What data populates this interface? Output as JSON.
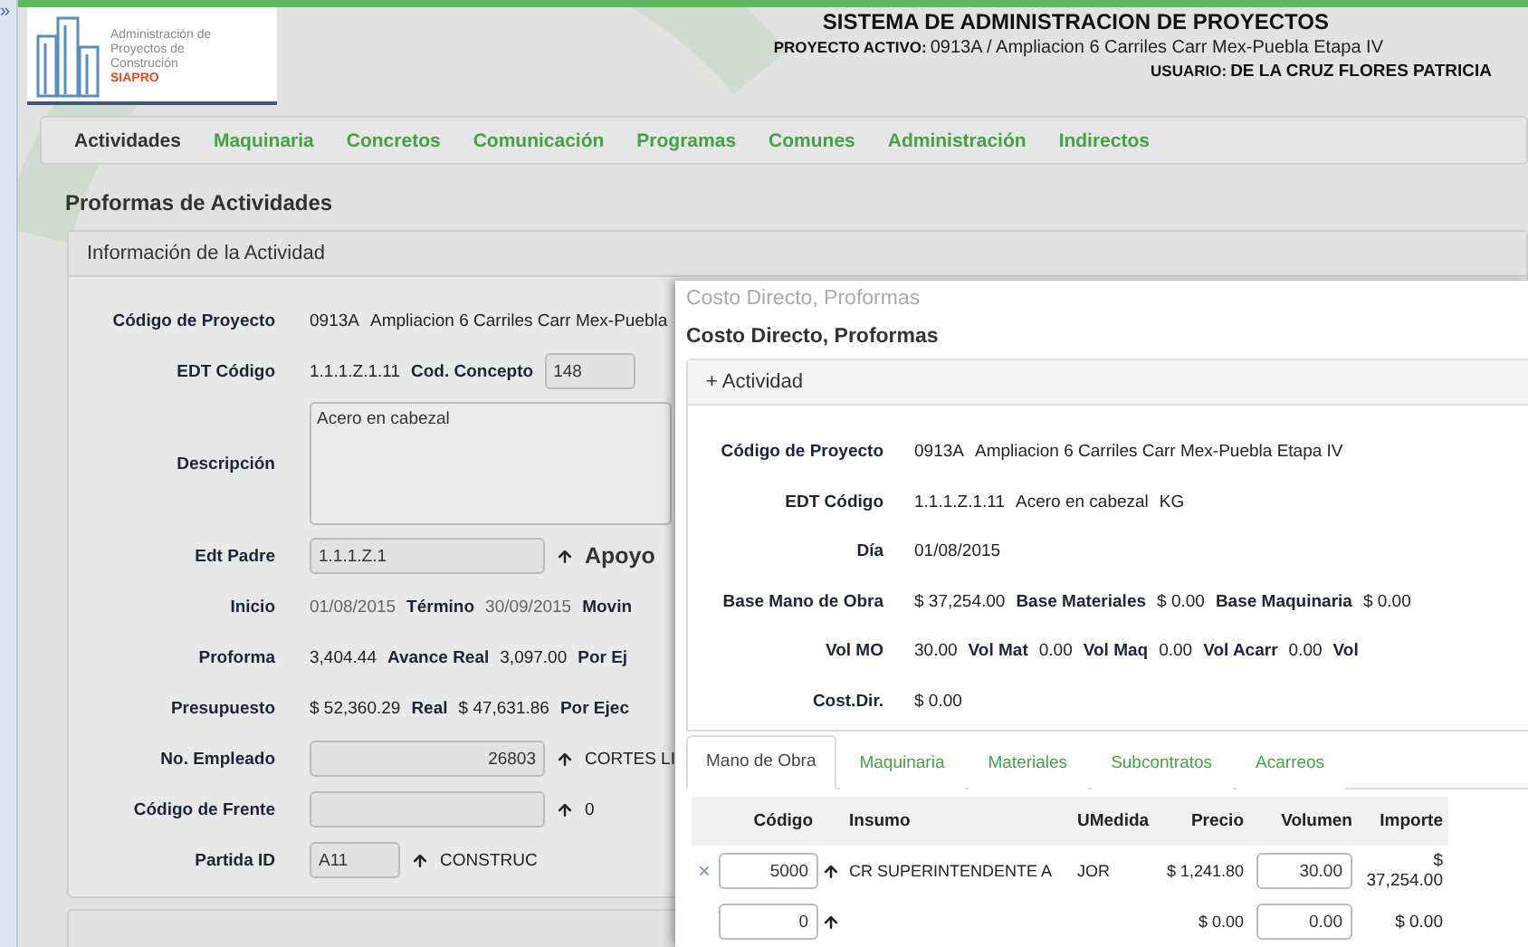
{
  "header": {
    "logo_text": "Administración de Proyectos de Construción",
    "logo_brand": "SIAPRO",
    "title": "SISTEMA DE ADMINISTRACION DE PROYECTOS",
    "project_label": "PROYECTO ACTIVO:",
    "project_value": "0913A / Ampliacion 6 Carriles Carr Mex-Puebla Etapa IV",
    "user_label": "USUARIO:",
    "user_value": "DE LA CRUZ FLORES PATRICIA"
  },
  "side_toggle": "»",
  "nav": [
    {
      "label": "Actividades",
      "selected": true
    },
    {
      "label": "Maquinaria",
      "selected": false
    },
    {
      "label": "Concretos",
      "selected": false
    },
    {
      "label": "Comunicación",
      "selected": false
    },
    {
      "label": "Programas",
      "selected": false
    },
    {
      "label": "Comunes",
      "selected": false
    },
    {
      "label": "Administración",
      "selected": false
    },
    {
      "label": "Indirectos",
      "selected": false
    }
  ],
  "page_title": "Proformas de Actividades",
  "activity_panel": {
    "title": "Información de la Actividad",
    "rows": [
      {
        "label": "Código de Proyecto",
        "items": [
          {
            "kind": "text",
            "text": "0913A"
          },
          {
            "kind": "text",
            "text": "Ampliacion 6 Carriles Carr Mex-Puebla"
          }
        ]
      },
      {
        "label": "EDT Código",
        "items": [
          {
            "kind": "text",
            "text": "1.1.1.Z.1.11"
          },
          {
            "kind": "label",
            "text": "Cod. Concepto"
          },
          {
            "kind": "field",
            "value": "148"
          }
        ]
      },
      {
        "label": "Descripción",
        "items": [
          {
            "kind": "textarea",
            "value": "Acero en cabezal"
          }
        ]
      },
      {
        "label": "Edt Padre",
        "items": [
          {
            "kind": "field",
            "value": "1.1.1.Z.1"
          },
          {
            "kind": "lookup"
          },
          {
            "kind": "big_label",
            "text": "Apoyo"
          }
        ]
      },
      {
        "label": "Inicio",
        "items": [
          {
            "kind": "muted",
            "text": "01/08/2015"
          },
          {
            "kind": "label",
            "text": "Término"
          },
          {
            "kind": "muted",
            "text": "30/09/2015"
          },
          {
            "kind": "label",
            "text": "Movin"
          }
        ]
      },
      {
        "label": "Proforma",
        "items": [
          {
            "kind": "text",
            "text": "3,404.44"
          },
          {
            "kind": "label",
            "text": "Avance Real"
          },
          {
            "kind": "text",
            "text": "3,097.00"
          },
          {
            "kind": "label",
            "text": "Por Ej"
          }
        ]
      },
      {
        "label": "Presupuesto",
        "items": [
          {
            "kind": "text",
            "text": "$ 52,360.29"
          },
          {
            "kind": "label",
            "text": "Real"
          },
          {
            "kind": "text",
            "text": "$ 47,631.86"
          },
          {
            "kind": "label",
            "text": "Por Ejec"
          }
        ]
      },
      {
        "label": "No. Empleado",
        "items": [
          {
            "kind": "number_field",
            "value": "26803"
          },
          {
            "kind": "lookup"
          },
          {
            "kind": "text",
            "text": "CORTES LI"
          }
        ]
      },
      {
        "label": "Código de Frente",
        "items": [
          {
            "kind": "field",
            "value": ""
          },
          {
            "kind": "lookup"
          },
          {
            "kind": "text",
            "text": "0"
          }
        ]
      },
      {
        "label": "Partida ID",
        "items": [
          {
            "kind": "field",
            "value": "A11"
          },
          {
            "kind": "lookup"
          },
          {
            "kind": "text",
            "text": "CONSTRUC"
          }
        ]
      }
    ]
  },
  "dialog": {
    "window_title": "Costo Directo, Proformas",
    "heading": "Costo Directo, Proformas",
    "panel_title": "+ Actividad",
    "rows": [
      {
        "label": "Código de Proyecto",
        "items": [
          {
            "kind": "text",
            "text": "0913A"
          },
          {
            "kind": "text",
            "text": "Ampliacion 6 Carriles Carr Mex-Puebla Etapa IV"
          }
        ]
      },
      {
        "label": "EDT Código",
        "items": [
          {
            "kind": "text",
            "text": "1.1.1.Z.1.11"
          },
          {
            "kind": "text",
            "text": "Acero en cabezal"
          },
          {
            "kind": "text",
            "text": "KG"
          }
        ]
      },
      {
        "label": "Día",
        "items": [
          {
            "kind": "text",
            "text": "01/08/2015"
          }
        ]
      },
      {
        "label": "Base Mano de Obra",
        "items": [
          {
            "kind": "text",
            "text": "$ 37,254.00"
          },
          {
            "kind": "label",
            "text": "Base Materiales"
          },
          {
            "kind": "text",
            "text": "$ 0.00"
          },
          {
            "kind": "label",
            "text": "Base Maquinaria"
          },
          {
            "kind": "text",
            "text": "$ 0.00"
          }
        ]
      },
      {
        "label": "Vol MO",
        "items": [
          {
            "kind": "text",
            "text": "30.00"
          },
          {
            "kind": "label",
            "text": "Vol Mat"
          },
          {
            "kind": "text",
            "text": "0.00"
          },
          {
            "kind": "label",
            "text": "Vol Maq"
          },
          {
            "kind": "text",
            "text": "0.00"
          },
          {
            "kind": "label",
            "text": "Vol Acarr"
          },
          {
            "kind": "text",
            "text": "0.00"
          },
          {
            "kind": "label",
            "text": "Vol"
          }
        ]
      },
      {
        "label": "Cost.Dir.",
        "items": [
          {
            "kind": "text",
            "text": "$ 0.00"
          }
        ]
      }
    ],
    "tabs": [
      {
        "label": "Mano de Obra",
        "selected": true
      },
      {
        "label": "Maquinaria",
        "selected": false
      },
      {
        "label": "Materiales",
        "selected": false
      },
      {
        "label": "Subcontratos",
        "selected": false
      },
      {
        "label": "Acarreos",
        "selected": false
      }
    ],
    "table": {
      "columns": [
        "Código",
        "Insumo",
        "UMedida",
        "Precio",
        "Volumen",
        "Importe"
      ],
      "rows": [
        {
          "removable": true,
          "codigo": "5000",
          "insumo": "CR SUPERINTENDENTE A",
          "umedida": "JOR",
          "precio": "$ 1,241.80",
          "volumen": "30.00",
          "importe": "$ 37,254.00"
        },
        {
          "removable": false,
          "codigo": "0",
          "insumo": "",
          "umedida": "",
          "precio": "$ 0.00",
          "volumen": "0.00",
          "importe": "$ 0.00"
        }
      ]
    }
  }
}
